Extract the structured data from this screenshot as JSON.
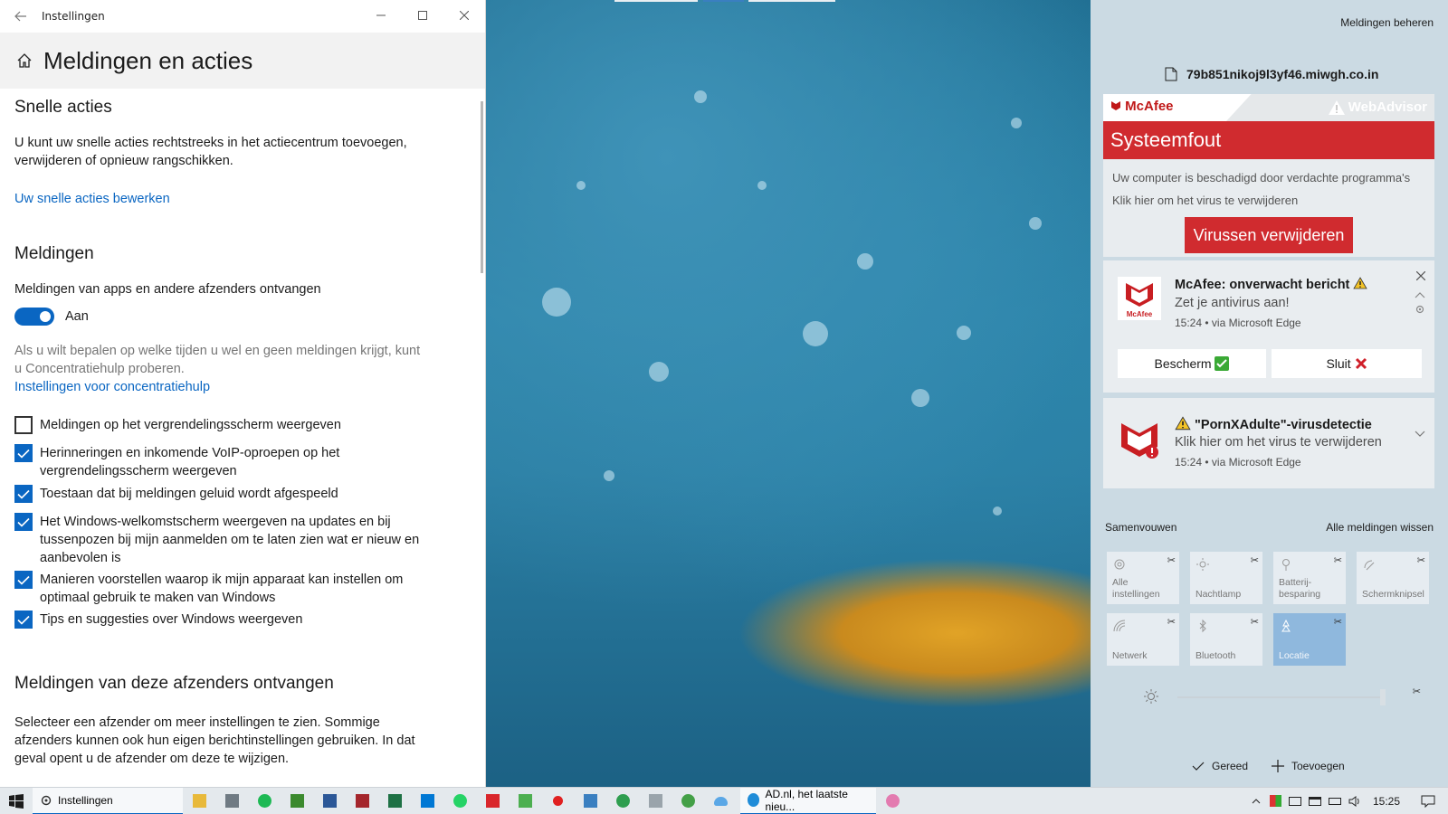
{
  "settings": {
    "window_title": "Instellingen",
    "page_title": "Meldingen en acties",
    "quick_actions": {
      "heading": "Snelle acties",
      "description": "U kunt uw snelle acties rechtstreeks in het actiecentrum toevoegen, verwijderen of opnieuw rangschikken.",
      "edit_link": "Uw snelle acties bewerken"
    },
    "notifications": {
      "heading": "Meldingen",
      "toggle_label": "Meldingen van apps en andere afzenders ontvangen",
      "toggle_state": "Aan",
      "toggle_on": true,
      "focus_hint": "Als u wilt bepalen op welke tijden u wel en geen meldingen krijgt, kunt u Concentratiehulp proberen.",
      "focus_link": "Instellingen voor concentratiehulp",
      "checkboxes": [
        {
          "label": "Meldingen op het vergrendelingsscherm weergeven",
          "checked": false
        },
        {
          "label": "Herinneringen en inkomende VoIP-oproepen op het vergrendelingsscherm weergeven",
          "checked": true
        },
        {
          "label": "Toestaan dat bij meldingen geluid wordt afgespeeld",
          "checked": true
        },
        {
          "label": "Het Windows-welkomstscherm weergeven na updates en bij tussenpozen bij mijn aanmelden om te laten zien wat er nieuw en aanbevolen is",
          "checked": true
        },
        {
          "label": "Manieren voorstellen waarop ik mijn apparaat kan instellen om optimaal gebruik te maken van Windows",
          "checked": true
        },
        {
          "label": "Tips en suggesties over Windows weergeven",
          "checked": true
        }
      ]
    },
    "senders": {
      "heading": "Meldingen van deze afzenders ontvangen",
      "description": "Selecteer een afzender om meer instellingen te zien. Sommige afzenders kunnen ook hun eigen berichtinstellingen gebruiken. In dat geval opent u de afzender om deze te wijzigen."
    }
  },
  "action_center": {
    "manage_link": "Meldingen beheren",
    "source_domain": "79b851nikoj9l3yf46.miwgh.co.in",
    "banner": {
      "brand": "McAfee",
      "product": "WebAdvisor",
      "headline": "Systeemfout",
      "line1": "Uw computer is beschadigd door verdachte programma's",
      "line2": "Klik hier om het virus te verwijderen",
      "button": "Virussen verwijderen"
    },
    "notification1": {
      "icon_caption": "McAfee",
      "title": "McAfee: onverwacht bericht",
      "body": "Zet je antivirus aan!",
      "meta": "15:24 • via Microsoft Edge",
      "btn1": "Bescherm",
      "btn2": "Sluit"
    },
    "notification2": {
      "title": "\"PornXAdulte\"-virusdetectie",
      "body": "Klik hier om het virus te verwijderen",
      "meta": "15:24 • via Microsoft Edge"
    },
    "collapse": "Samenvouwen",
    "clear_all": "Alle meldingen wissen",
    "tiles": [
      {
        "label": "Alle instellingen",
        "icon": "gear-icon",
        "active": false
      },
      {
        "label": "Nachtlamp",
        "icon": "sun-icon",
        "active": false
      },
      {
        "label": "Batterij-besparing",
        "icon": "battery-saver-icon",
        "active": false
      },
      {
        "label": "Schermknipsel",
        "icon": "screen-snip-icon",
        "active": false
      },
      {
        "label": "Netwerk",
        "icon": "network-icon",
        "active": false
      },
      {
        "label": "Bluetooth",
        "icon": "bluetooth-icon",
        "active": false
      },
      {
        "label": "Locatie",
        "icon": "location-icon",
        "active": true
      }
    ],
    "done": "Gereed",
    "add": "Toevoegen"
  },
  "taskbar": {
    "settings_app": "Instellingen",
    "edge_app": "AD.nl, het laatste nieu...",
    "clock": "15:25"
  },
  "colors": {
    "accent": "#0a66c2",
    "mcafee_red": "#d02b2f"
  }
}
